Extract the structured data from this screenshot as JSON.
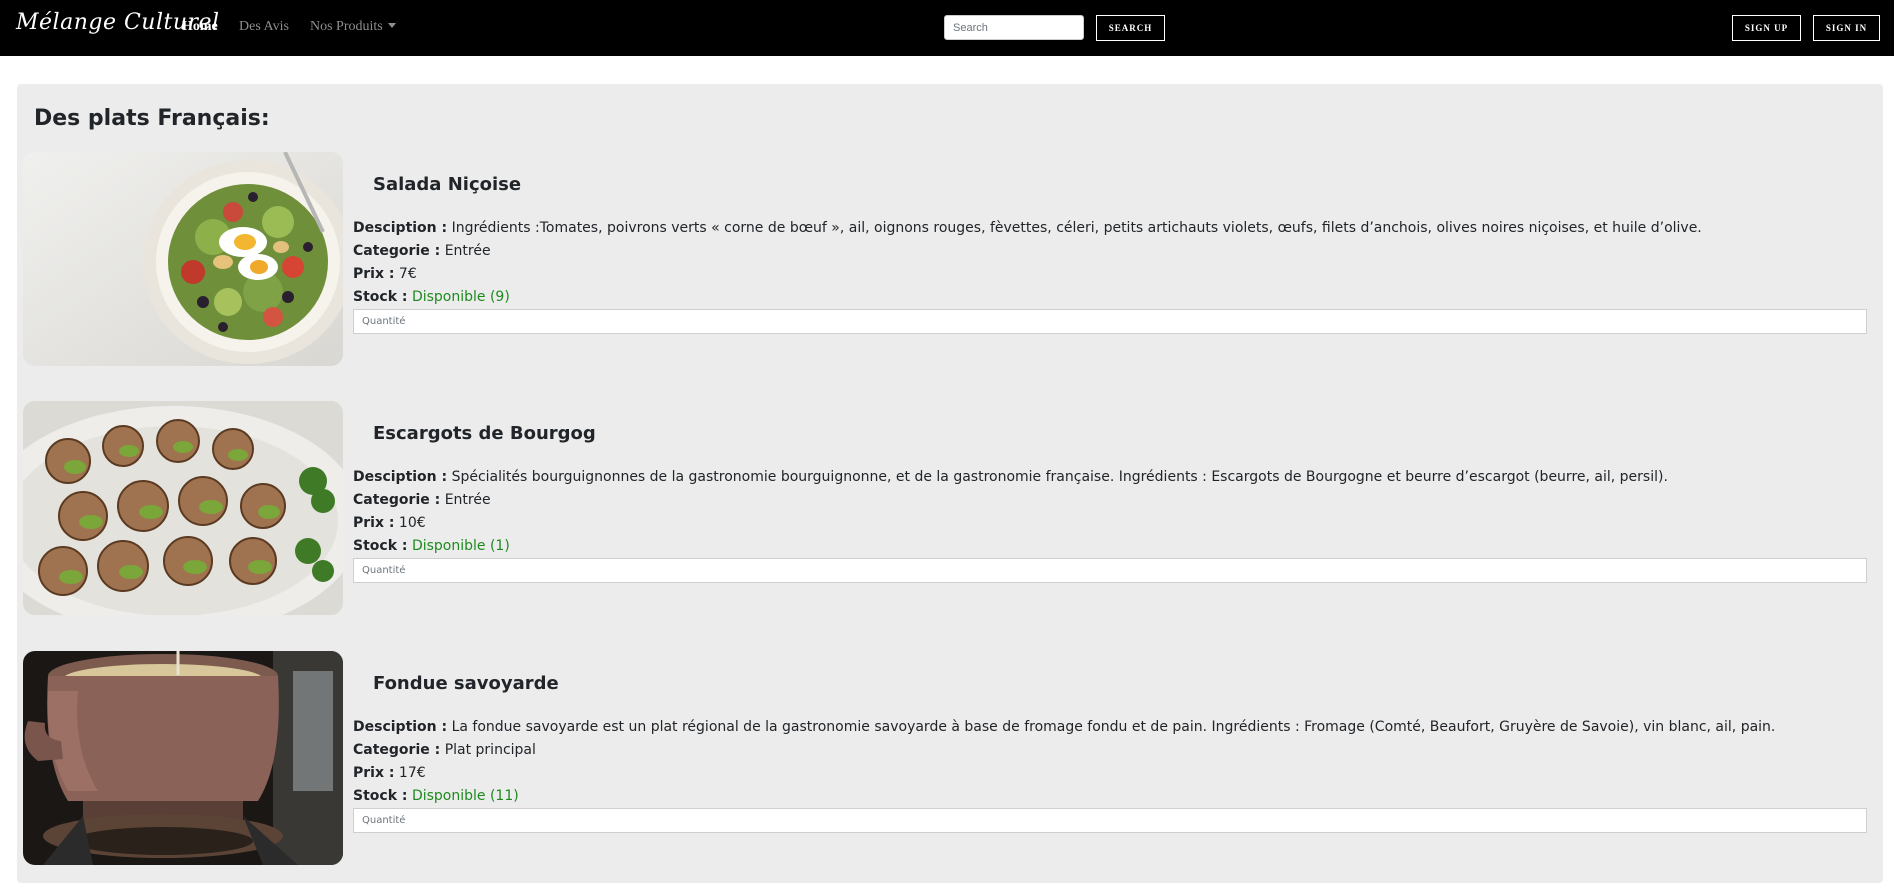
{
  "nav": {
    "brand": "Mélange Culturel",
    "links": [
      "Home",
      "Des Avis",
      "Nos Produits"
    ],
    "search_placeholder": "Search",
    "search_button": "SEARCH",
    "signup": "SIGN UP",
    "signin": "SIGN IN"
  },
  "main": {
    "title": "Des plats Français:",
    "labels": {
      "description": "Desciption :",
      "category": "Categorie :",
      "price": "Prix :",
      "stock": "Stock :"
    },
    "products": [
      {
        "name": "Salada Niçoise",
        "description": "Ingrédients :Tomates, poivrons verts « corne de bœuf », ail, oignons rouges, fèvettes, céleri, petits artichauts violets, œufs, filets d’anchois, olives noires niçoises, et huile d’olive.",
        "category": "Entrée",
        "price": "7€",
        "stock": "Disponible (9)",
        "qty_placeholder": "Quantité"
      },
      {
        "name": "Escargots de Bourgog",
        "description": "Spécialités bourguignonnes de la gastronomie bourguignonne, et de la gastronomie française. Ingrédients : Escargots de Bourgogne et beurre d’escargot (beurre, ail, persil).",
        "category": "Entrée",
        "price": "10€",
        "stock": "Disponible (1)",
        "qty_placeholder": "Quantité"
      },
      {
        "name": "Fondue savoyarde",
        "description": "La fondue savoyarde est un plat régional de la gastronomie savoyarde à base de fromage fondu et de pain. Ingrédients : Fromage (Comté, Beaufort, Gruyère de Savoie), vin blanc, ail, pain.",
        "category": "Plat principal",
        "price": "17€",
        "stock": "Disponible (11)",
        "qty_placeholder": "Quantité"
      }
    ]
  },
  "colors": {
    "navbar_bg": "#000000",
    "content_bg": "#ececec",
    "stock_green": "#1e8a1e"
  }
}
